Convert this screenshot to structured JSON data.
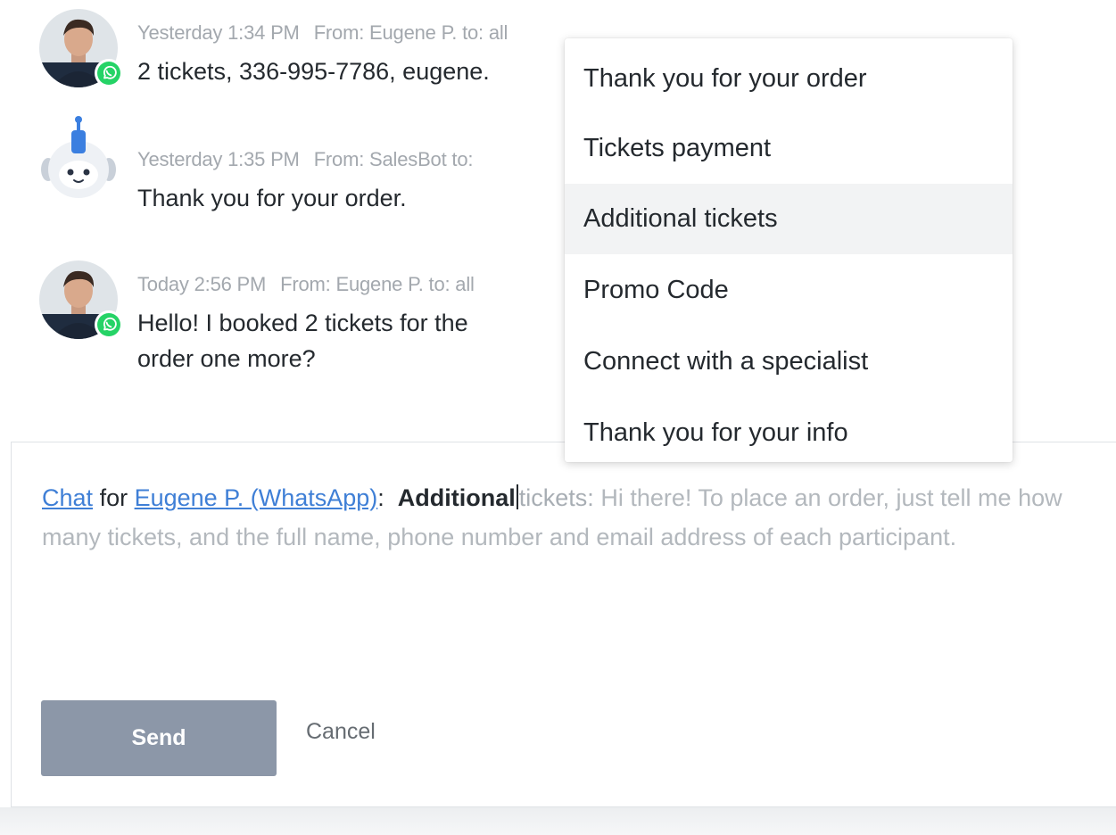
{
  "messages": [
    {
      "timestamp": "Yesterday 1:34 PM",
      "from_label": "From: Eugene P. to: all",
      "text": "2 tickets, 336-995-7786, eugene.",
      "avatar_icon": "user-photo",
      "channel_icon": "whatsapp-icon"
    },
    {
      "timestamp": "Yesterday 1:35 PM",
      "from_label": "From: SalesBot to:",
      "text": "Thank you for your order.",
      "avatar_icon": "robot-avatar"
    },
    {
      "timestamp": "Today 2:56 PM",
      "from_label": "From: Eugene P. to: all",
      "text": "Hello! I booked 2 tickets for the",
      "text_line2": "order one more?",
      "avatar_icon": "user-photo",
      "channel_icon": "whatsapp-icon"
    }
  ],
  "composer": {
    "chat_link": "Chat",
    "for_word": "for",
    "recipient_link": "Eugene P. (WhatsApp)",
    "colon": ":",
    "typed_text": "Additional",
    "suggestion_title_rest": "tickets:",
    "suggestion_body": "Hi there! To place an order, just tell me how many tickets, and the full name, phone number and email address of each participant.",
    "send_label": "Send",
    "cancel_label": "Cancel"
  },
  "template_dropdown": {
    "items": [
      "Thank you for your order",
      "Tickets payment",
      "Additional tickets",
      "Promo Code",
      "Connect with a specialist",
      "Thank you for your info"
    ],
    "active_item": "Additional tickets"
  },
  "colors": {
    "link": "#3f7fd6",
    "send_button": "#8c97a8",
    "whatsapp": "#25d366",
    "hint_text": "#b3b8bd"
  }
}
